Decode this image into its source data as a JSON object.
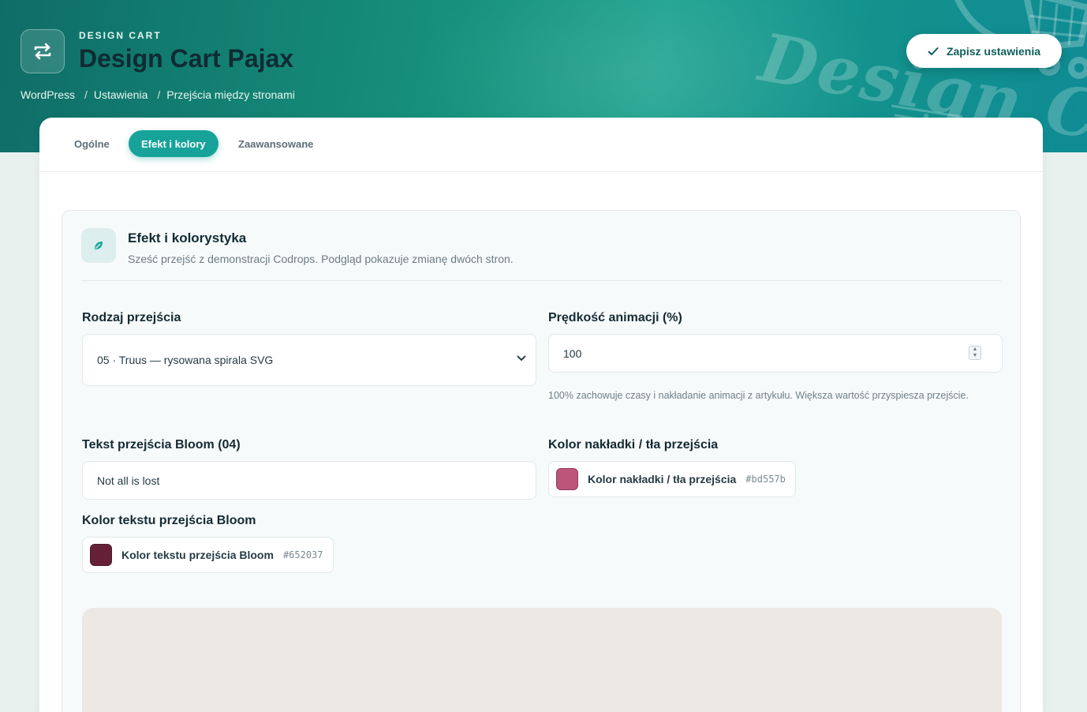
{
  "header": {
    "eyebrow": "DESIGN CART",
    "title": "Design Cart Pajax",
    "logo_icon": "swap-arrows-icon",
    "watermark": "Design C",
    "breadcrumb": [
      "WordPress",
      "Ustawienia",
      "Przejścia między stronami"
    ],
    "breadcrumb_separator": "/",
    "save_label": "Zapisz ustawienia"
  },
  "tabs": [
    {
      "label": "Ogólne",
      "active": false
    },
    {
      "label": "Efekt i kolory",
      "active": true
    },
    {
      "label": "Zaawansowane",
      "active": false
    }
  ],
  "card": {
    "icon": "leaf-icon",
    "title": "Efekt i kolorystyka",
    "subtitle": "Sześć przejść z demonstracji Codrops. Podgląd pokazuje zmianę dwóch stron."
  },
  "fields": {
    "transition_type": {
      "label": "Rodzaj przejścia",
      "value": "05 · Truus — rysowana spirala SVG"
    },
    "speed": {
      "label": "Prędkość animacji (%)",
      "value": "100",
      "hint": "100% zachowuje czasy i nakładanie animacji z artykułu. Większa wartość przyspiesza przejście."
    },
    "bloom_text": {
      "label": "Tekst przejścia Bloom (04)",
      "value": "Not all is lost"
    },
    "overlay_color": {
      "label": "Kolor nakładki / tła przejścia",
      "chip_label": "Kolor nakładki / tła przejścia",
      "hex": "#bd557b"
    },
    "bloom_text_color": {
      "label": "Kolor tekstu przejścia Bloom",
      "chip_label": "Kolor tekstu przejścia Bloom",
      "hex": "#652037"
    }
  },
  "colors": {
    "accent": "#17a39a",
    "preview_bg": "#ece8e4"
  }
}
